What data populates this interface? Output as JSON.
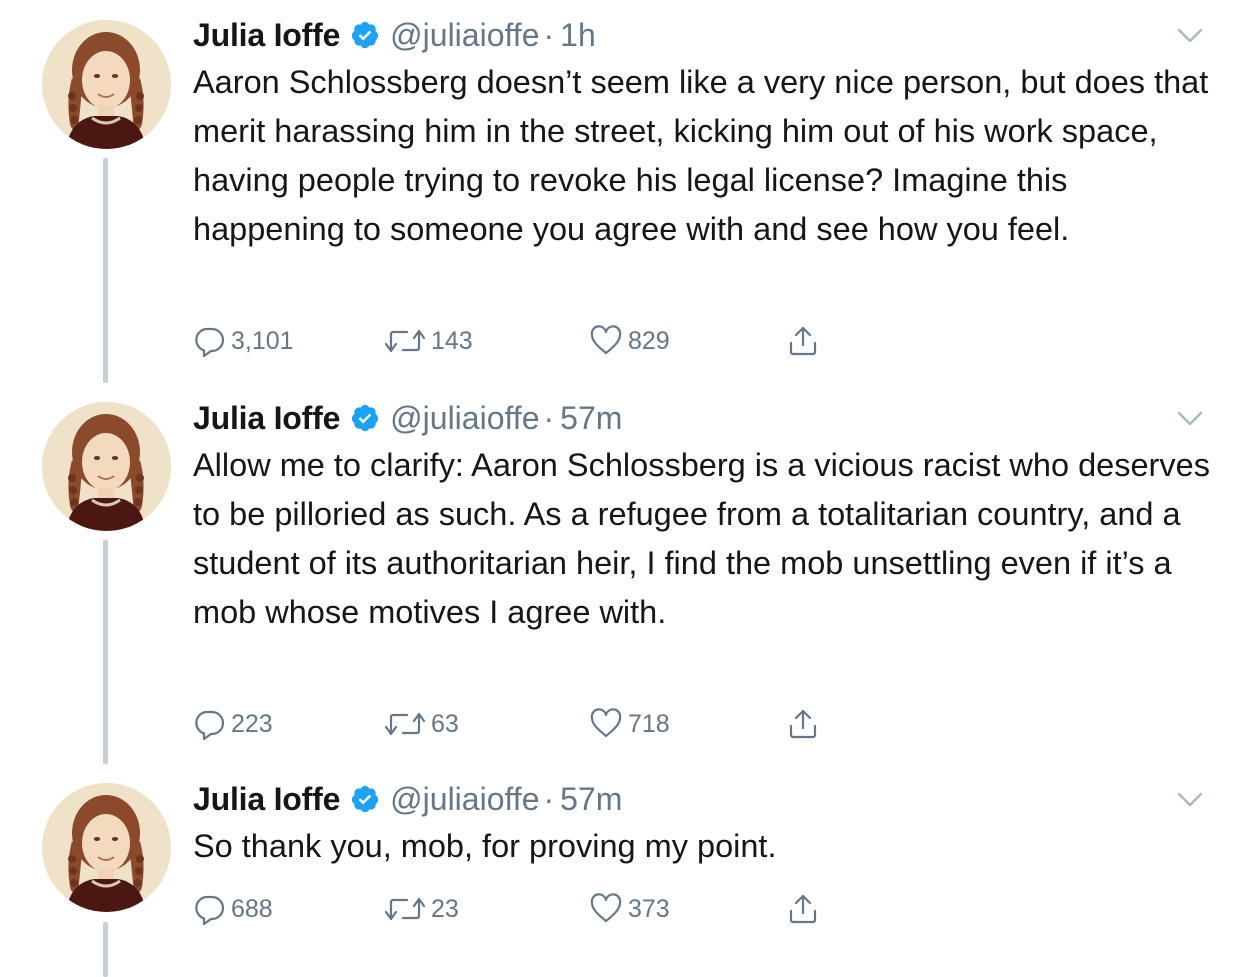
{
  "colors": {
    "text": "#14171a",
    "secondary": "#657786",
    "verified": "#1da1f2",
    "thread_line": "#c4cfd6"
  },
  "tweets": [
    {
      "author": "Julia Ioffe",
      "handle": "@juliaioffe",
      "separator": "·",
      "time": "1h",
      "text": "Aaron Schlossberg doesn’t seem like a very nice person, but does that merit harassing him in the street, kicking him out of his work space, having people trying to revoke his legal license? Imagine this happening to someone you agree with and see how you feel.",
      "replies": "3,101",
      "retweets": "143",
      "likes": "829"
    },
    {
      "author": "Julia Ioffe",
      "handle": "@juliaioffe",
      "separator": "·",
      "time": "57m",
      "text": "Allow me to clarify: Aaron Schlossberg is a vicious racist who deserves to be pilloried as such. As a refugee from a totalitarian country, and a student of its authoritarian heir, I find the mob unsettling even if it’s a mob whose motives I agree with.",
      "replies": "223",
      "retweets": "63",
      "likes": "718"
    },
    {
      "author": "Julia Ioffe",
      "handle": "@juliaioffe",
      "separator": "·",
      "time": "57m",
      "text": "So thank you, mob, for proving my point.",
      "replies": "688",
      "retweets": "23",
      "likes": "373"
    }
  ],
  "icons": {
    "verified": "verified-badge-icon",
    "caret": "chevron-down-icon",
    "reply": "reply-icon",
    "retweet": "retweet-icon",
    "like": "heart-icon",
    "share": "share-icon",
    "avatar": "avatar-photo"
  }
}
